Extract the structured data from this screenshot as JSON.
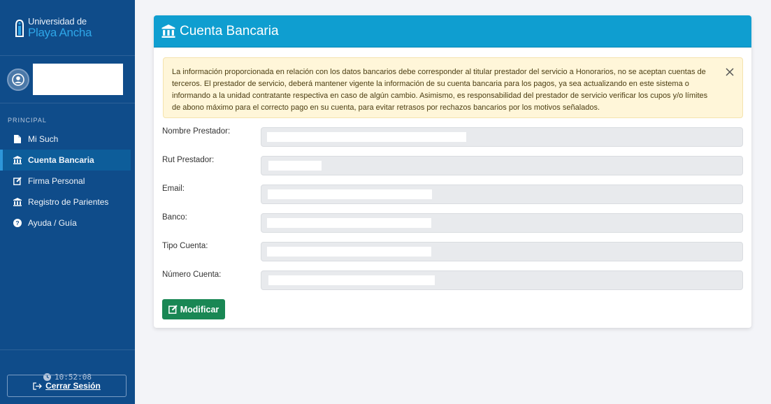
{
  "brand": {
    "line1": "Universidad de",
    "line2": "Playa Ancha"
  },
  "sidebar": {
    "section": "PRINCIPAL",
    "items": [
      {
        "label": "Mi Such",
        "icon": "file-icon",
        "active": false
      },
      {
        "label": "Cuenta Bancaria",
        "icon": "bank-icon",
        "active": true
      },
      {
        "label": "Firma Personal",
        "icon": "edit-icon",
        "active": false
      },
      {
        "label": "Registro de Parientes",
        "icon": "bank-icon",
        "active": false
      },
      {
        "label": "Ayuda / Guía",
        "icon": "help-icon",
        "active": false
      }
    ],
    "clock": "10:52:08",
    "logout_label": "Cerrar Sesión"
  },
  "card": {
    "title": "Cuenta Bancaria",
    "alert": "La información proporcionada en relación con los datos bancarios debe corresponder al titular prestador del servicio a Honorarios, no se aceptan cuentas de terceros. El prestador de servicio, deberá mantener vigente la información de su cuenta bancaria para los pagos, ya sea actualizando en este sistema o informando a la unidad contratante respectiva en caso de algún cambio. Asimismo, es responsabilidad del prestador de servicio verificar los cupos y/o límites de abono máximo para el correcto pago en su cuenta, para evitar retrasos por rechazos bancarios por los motivos señalados.",
    "fields": [
      {
        "label": "Nombre Prestador:"
      },
      {
        "label": "Rut Prestador:"
      },
      {
        "label": "Email:"
      },
      {
        "label": "Banco:"
      },
      {
        "label": "Tipo Cuenta:"
      },
      {
        "label": "Número Cuenta:"
      }
    ],
    "button_label": "Modificar"
  },
  "colors": {
    "sidebar": "#0f4c8a",
    "header": "#0f9ed0",
    "button": "#198754",
    "alert_bg": "#fff6d9"
  }
}
